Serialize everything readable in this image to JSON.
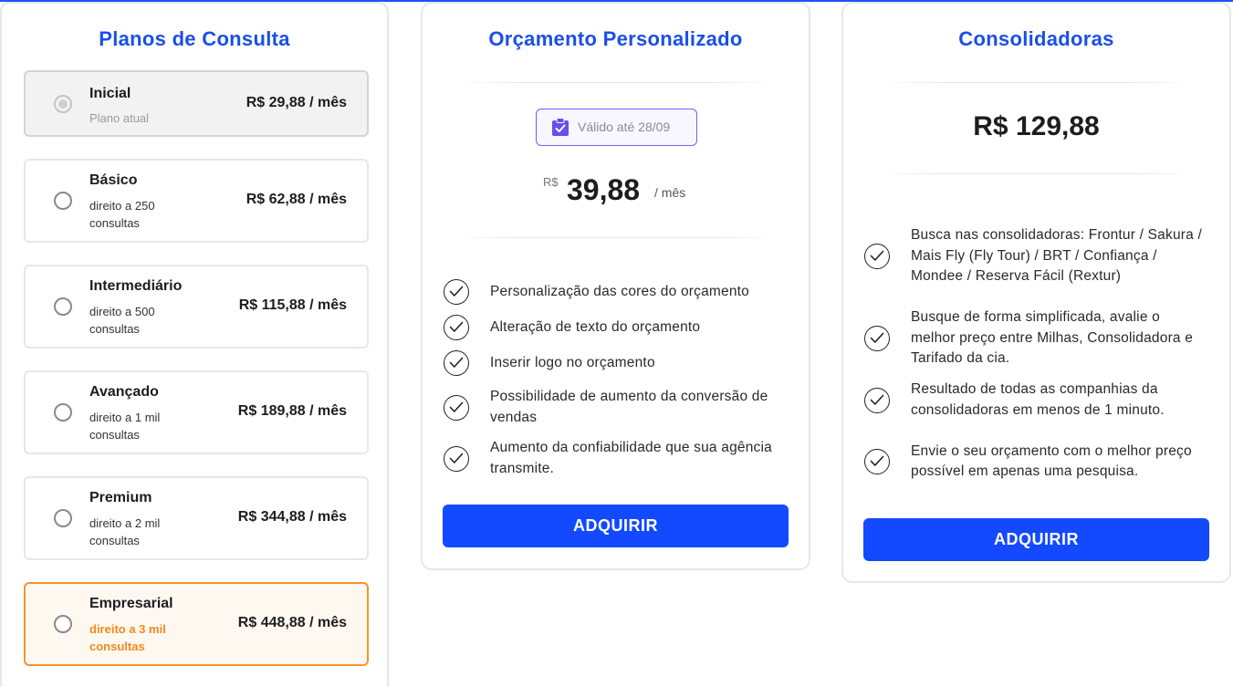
{
  "colors": {
    "accent": "#1a4fe8",
    "button": "#1349ff",
    "featured": "#f7942a",
    "badge_border": "#7b5bf0"
  },
  "plans_card": {
    "title": "Planos de Consulta",
    "plans": [
      {
        "name": "Inicial",
        "subtitle": "Plano atual",
        "price": "R$ 29,88 / mês",
        "state": "current"
      },
      {
        "name": "Básico",
        "subtitle": "direito a 250 consultas",
        "price": "R$ 62,88 / mês",
        "state": "default"
      },
      {
        "name": "Intermediário",
        "subtitle": "direito a 500 consultas",
        "price": "R$ 115,88 / mês",
        "state": "default"
      },
      {
        "name": "Avançado",
        "subtitle": "direito a 1 mil consultas",
        "price": "R$ 189,88 / mês",
        "state": "default"
      },
      {
        "name": "Premium",
        "subtitle": "direito a 2 mil consultas",
        "price": "R$ 344,88 / mês",
        "state": "default"
      },
      {
        "name": "Empresarial",
        "subtitle": "direito a 3 mil consultas",
        "price": "R$ 448,88 / mês",
        "state": "featured"
      }
    ]
  },
  "orcamento_card": {
    "title": "Orçamento Personalizado",
    "badge": {
      "icon": "clipboard-check-icon",
      "text": "Válido até 28/09"
    },
    "price": {
      "currency": "R$",
      "amount": "39,88",
      "period": "/ mês"
    },
    "features": [
      "Personalização das cores do orçamento",
      "Alteração de texto do orçamento",
      "Inserir logo no orçamento",
      "Possibilidade de aumento da conversão de vendas",
      "Aumento da confiabilidade que sua agência transmite."
    ],
    "button": "ADQUIRIR"
  },
  "consolidadoras_card": {
    "title": "Consolidadoras",
    "price": "R$ 129,88",
    "features": [
      "Busca nas consolidadoras: Frontur / Sakura / Mais Fly (Fly Tour) /  BRT / Confiança / Mondee / Reserva Fácil (Rextur)",
      "Busque de forma simplificada, avalie o melhor preço entre Milhas, Consolidadora e Tarifado da cia.",
      "Resultado de todas as companhias da consolidadoras em menos de 1 minuto.",
      "Envie o seu orçamento com o melhor preço possível em apenas uma pesquisa."
    ],
    "button": "ADQUIRIR"
  }
}
